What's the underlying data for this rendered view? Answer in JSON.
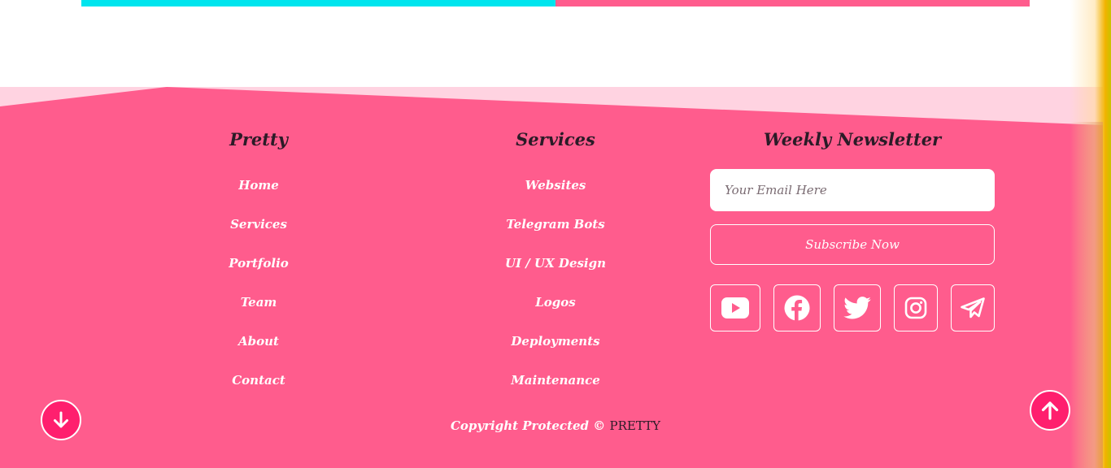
{
  "colors": {
    "accent_cyan": "#00e5ee",
    "accent_pink": "#ff5c8d",
    "footer_background": "#ff5c8d",
    "footer_light_band": "#ffd3e1",
    "heading_text": "#2b1b27",
    "scroll_button": "#ff1f6e"
  },
  "footer": {
    "pretty_column": {
      "title": "Pretty",
      "links": [
        "Home",
        "Services",
        "Portfolio",
        "Team",
        "About",
        "Contact"
      ]
    },
    "services_column": {
      "title": "Services",
      "links": [
        "Websites",
        "Telegram Bots",
        "UI / UX Design",
        "Logos",
        "Deployments",
        "Maintenance"
      ]
    },
    "newsletter_column": {
      "title": "Weekly Newsletter",
      "email_placeholder": "Your Email Here",
      "subscribe_label": "Subscribe Now",
      "social_icons": [
        "youtube-icon",
        "facebook-icon",
        "twitter-icon",
        "instagram-icon",
        "telegram-icon"
      ]
    },
    "copyright": {
      "text": "Copyright Protected © ",
      "brand": "PRETTY"
    }
  },
  "scroll_buttons": {
    "down_icon": "arrow-down-icon",
    "up_icon": "arrow-up-icon"
  }
}
